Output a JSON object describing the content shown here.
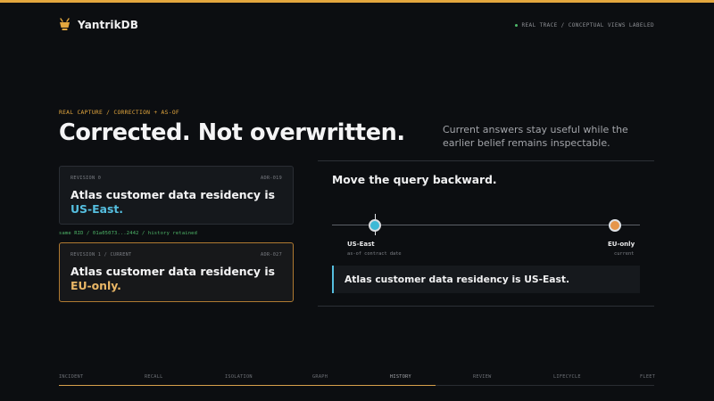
{
  "brand": {
    "name": "YantrikDB",
    "icon": "bowl-logo-icon"
  },
  "status": {
    "text": "REAL TRACE / CONCEPTUAL VIEWS LABELED",
    "dot_color": "#4fb96a"
  },
  "hero": {
    "eyebrow": "REAL CAPTURE / CORRECTION + AS-OF",
    "title": "Corrected. Not overwritten.",
    "subtitle": "Current answers stay useful while the earlier belief remains inspectable."
  },
  "revisions": {
    "old": {
      "label": "REVISION 0",
      "adr": "ADR-019",
      "statement_prefix": "Atlas customer data residency is ",
      "value": "US-East."
    },
    "rid_line": "same RID / 01a05073...2442 / history retained",
    "current": {
      "label": "REVISION 1 / CURRENT",
      "adr": "ADR-027",
      "statement_prefix": "Atlas customer data residency is ",
      "value": "EU-only."
    }
  },
  "query_panel": {
    "title": "Move the query backward.",
    "points": {
      "past": {
        "label": "US-East",
        "sub": "as-of contract date"
      },
      "now": {
        "label": "EU-only",
        "sub": "current"
      }
    },
    "answer": "Atlas customer data residency is US-East."
  },
  "nav": {
    "tabs": [
      "INCIDENT",
      "RECALL",
      "ISOLATION",
      "GRAPH",
      "HISTORY",
      "REVIEW",
      "LIFECYCLE",
      "FLEET"
    ],
    "active": "HISTORY",
    "progress": 0.632
  },
  "colors": {
    "accent": "#e3a73e",
    "past_value": "#55bfe0",
    "current_value": "#eab766",
    "background": "#0c0e11"
  }
}
